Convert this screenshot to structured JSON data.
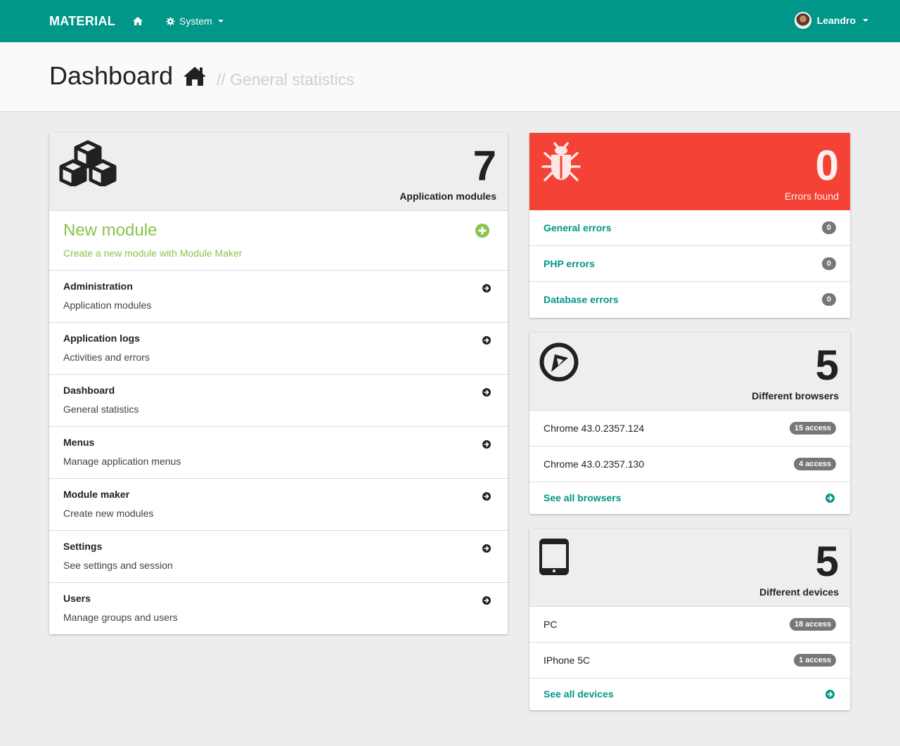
{
  "navbar": {
    "brand": "MATERIAL",
    "system_label": "System",
    "user_name": "Leandro",
    "bg_color": "#009688"
  },
  "header": {
    "title": "Dashboard",
    "subtitle": "// General statistics"
  },
  "modules": {
    "count": "7",
    "label": "Application modules",
    "new_module": {
      "title": "New module",
      "subtitle": "Create a new module with Module Maker",
      "color": "#8bc34a"
    },
    "items": [
      {
        "title": "Administration",
        "subtitle": "Application modules"
      },
      {
        "title": "Application logs",
        "subtitle": "Activities and errors"
      },
      {
        "title": "Dashboard",
        "subtitle": "General statistics"
      },
      {
        "title": "Menus",
        "subtitle": "Manage application menus"
      },
      {
        "title": "Module maker",
        "subtitle": "Create new modules"
      },
      {
        "title": "Settings",
        "subtitle": "See settings and session"
      },
      {
        "title": "Users",
        "subtitle": "Manage groups and users"
      }
    ]
  },
  "errors": {
    "count": "0",
    "label": "Errors found",
    "color": "#f44336",
    "items": [
      {
        "label": "General errors",
        "count": "0"
      },
      {
        "label": "PHP errors",
        "count": "0"
      },
      {
        "label": "Database errors",
        "count": "0"
      }
    ]
  },
  "browsers": {
    "count": "5",
    "label": "Different browsers",
    "items": [
      {
        "name": "Chrome 43.0.2357.124",
        "access": "15 access"
      },
      {
        "name": "Chrome 43.0.2357.130",
        "access": "4 access"
      }
    ],
    "see_all": "See all browsers"
  },
  "devices": {
    "count": "5",
    "label": "Different devices",
    "items": [
      {
        "name": "PC",
        "access": "18 access"
      },
      {
        "name": "IPhone 5C",
        "access": "1 access"
      }
    ],
    "see_all": "See all devices"
  }
}
